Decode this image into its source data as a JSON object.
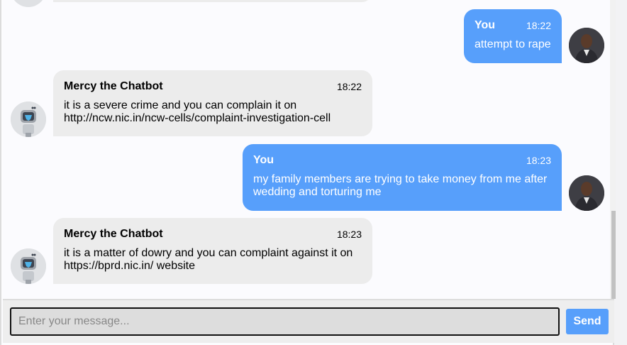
{
  "colors": {
    "user_bubble": "#579ffb",
    "bot_bubble": "#ececec",
    "send_button": "#579ffb"
  },
  "messages": [
    {
      "role": "user",
      "name": "You",
      "time": "18:22",
      "text": "attempt to rape",
      "avatar": "user-photo"
    },
    {
      "role": "bot",
      "name": "Mercy the Chatbot",
      "time": "18:22",
      "text": "it is a severe crime and you can complain it on http://ncw.nic.in/ncw-cells/complaint-investigation-cell",
      "avatar": "robot-icon"
    },
    {
      "role": "user",
      "name": "You",
      "time": "18:23",
      "text": "my family members are trying to take money from me after wedding and torturing me",
      "avatar": "user-photo"
    },
    {
      "role": "bot",
      "name": "Mercy the Chatbot",
      "time": "18:23",
      "text": "it is a matter of dowry and you can complaint against it on https://bprd.nic.in/ website",
      "avatar": "robot-icon"
    }
  ],
  "composer": {
    "placeholder": "Enter your message...",
    "value": "",
    "send_label": "Send"
  }
}
